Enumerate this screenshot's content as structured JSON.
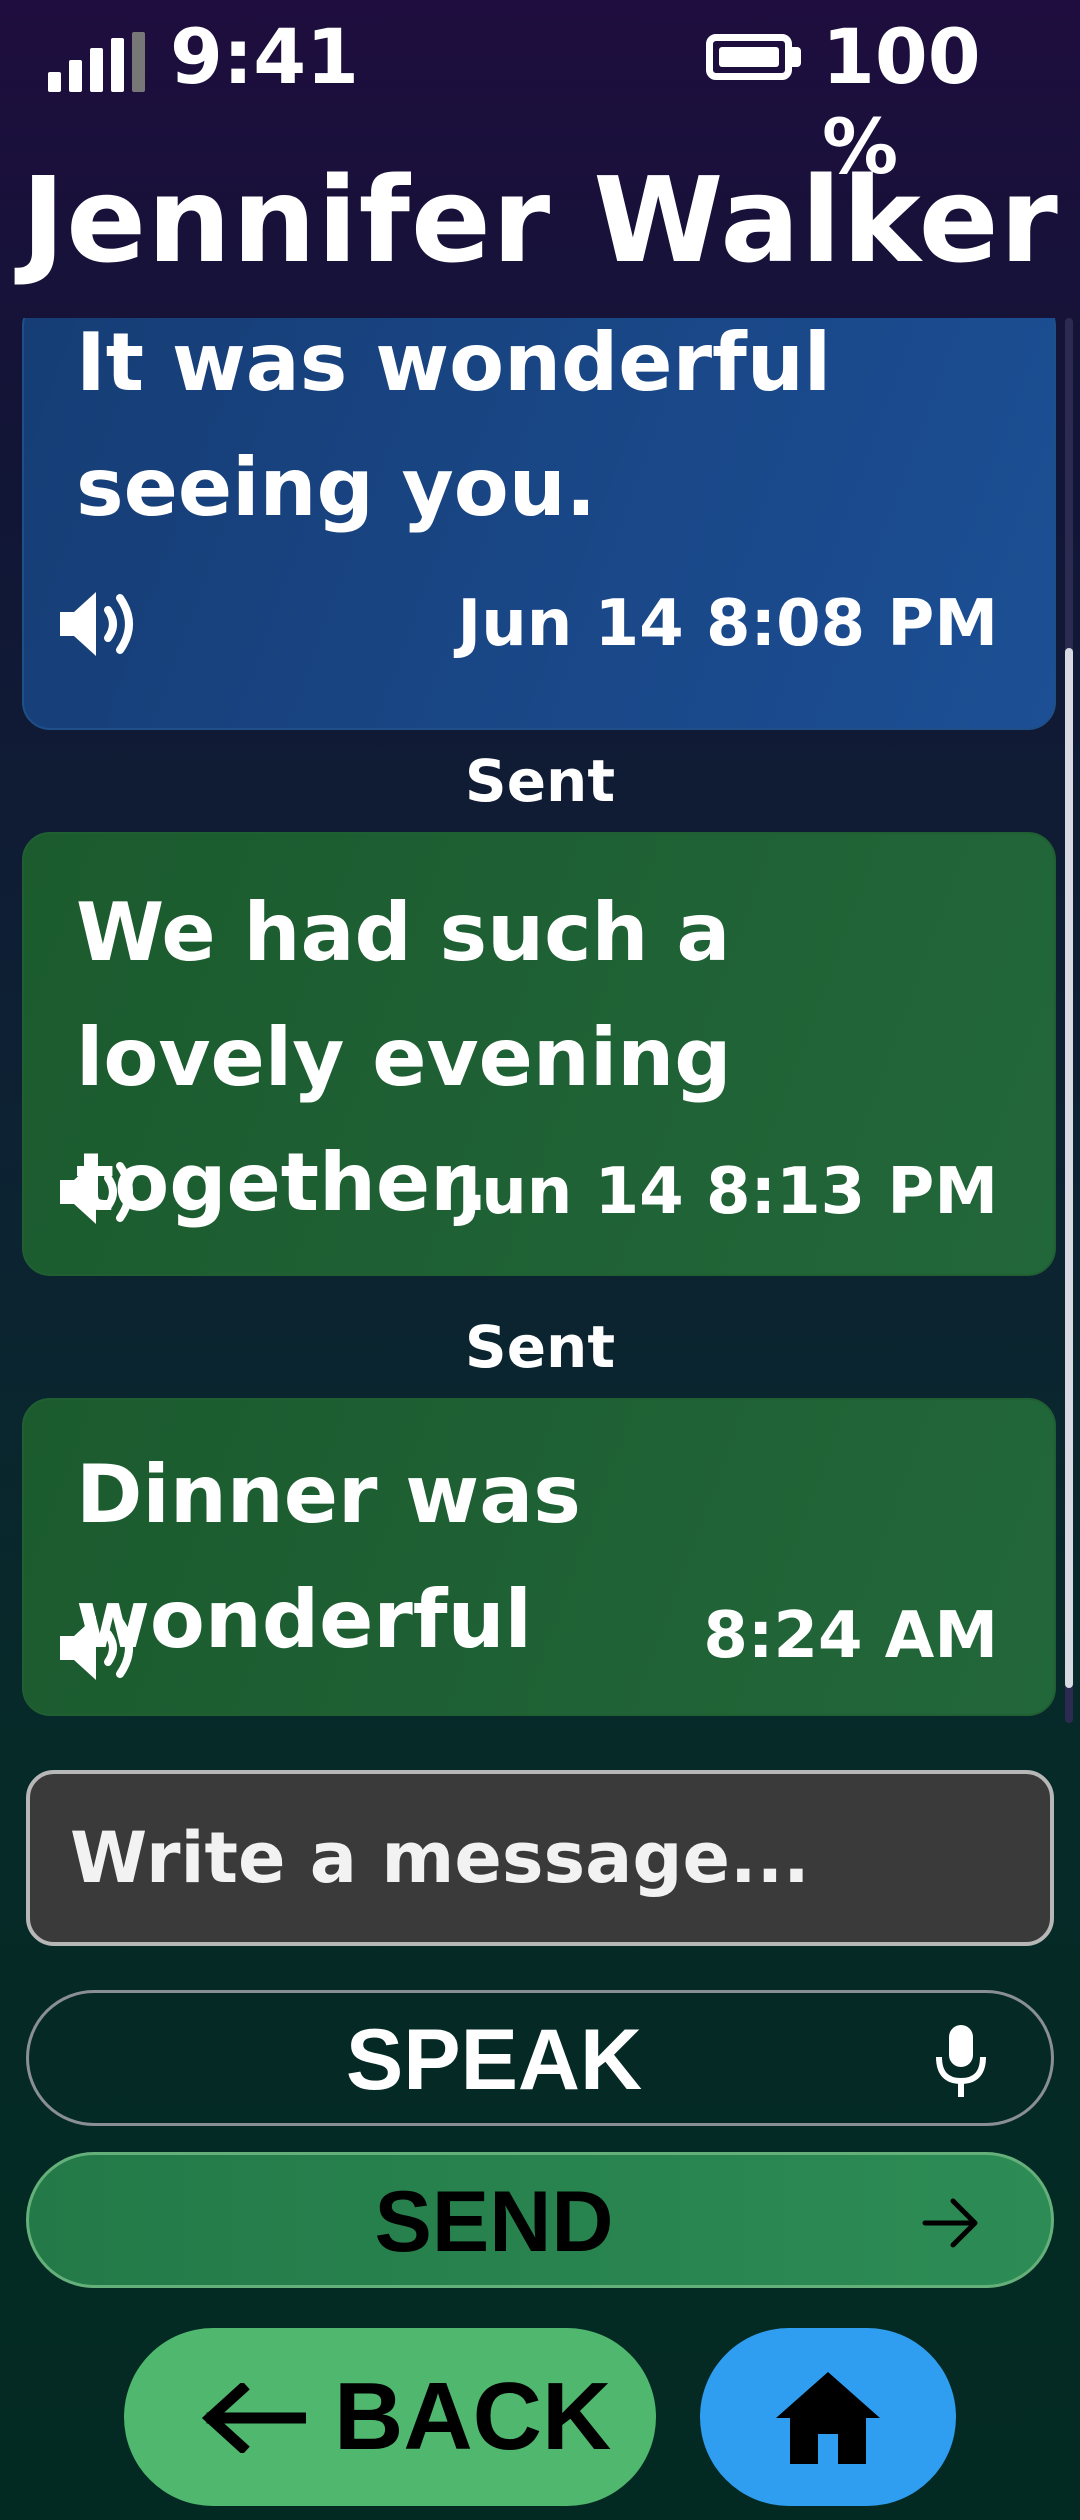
{
  "status_bar": {
    "time": "9:41",
    "battery_percent": "100 %",
    "icons": [
      "signal-icon",
      "battery-icon"
    ]
  },
  "header": {
    "contact_name": "Jennifer Walker"
  },
  "messages": [
    {
      "direction": "received",
      "text": "It was wonderful seeing you.",
      "timestamp": "Jun 14 8:08 PM",
      "icon": "speaker-icon"
    },
    {
      "direction": "sent",
      "status": "Sent",
      "text": "We had such a lovely evening together.",
      "timestamp": "Jun 14 8:13 PM",
      "icon": "speaker-icon"
    },
    {
      "direction": "sent",
      "status": "Sent",
      "text": "Dinner was wonderful",
      "timestamp": "8:24 AM",
      "icon": "speaker-icon"
    }
  ],
  "composer": {
    "placeholder": "Write a message...",
    "speak_label": "SPEAK",
    "send_label": "SEND"
  },
  "nav": {
    "back_label": "BACK",
    "home_icon": "home-icon"
  },
  "colors": {
    "received_bubble": "#1c4f95",
    "sent_bubble": "#22673a",
    "send_button": "#2d8c55",
    "back_button": "#4fb86e",
    "home_button": "#2f9ef0"
  }
}
